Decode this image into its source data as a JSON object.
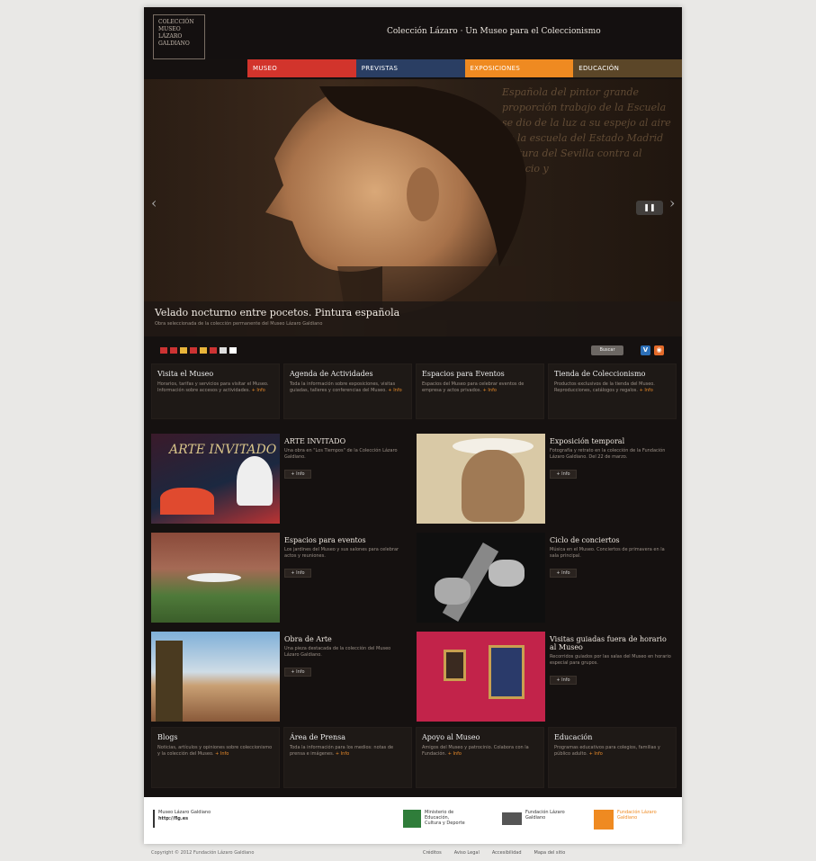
{
  "header": {
    "logo_text": "COLECCIÓN MUSEO LÁZARO GALDIANO",
    "title": "Colección Lázaro · Un Museo para el Coleccionismo"
  },
  "nav": [
    {
      "label": "MUSEO",
      "color": "#d2342c"
    },
    {
      "label": "PREVISTAS",
      "color": "#2a3e63"
    },
    {
      "label": "EXPOSICIONES",
      "color": "#ef8a21"
    },
    {
      "label": "EDUCACIÓN",
      "color": "#5b4628"
    }
  ],
  "hero": {
    "caption_title": "Velado nocturno entre pocetos. Pintura española",
    "caption_sub": "Obra seleccionada de la colección permanente del Museo Lázaro Galdiano",
    "background_text": "Española del pintor grande proporción trabajo de la Escuela se dio de la luz a su espejo al aire de la escuela del Estado Madrid pintura del Sevilla contra al espacio y"
  },
  "toolbar": {
    "search_label": "Buscar"
  },
  "flag_colors": [
    "#c33",
    "#c33",
    "#e8b43a",
    "#c33",
    "#e8b43a",
    "#c33",
    "#ddd",
    "#fff"
  ],
  "boxes": [
    {
      "title": "Visita el Museo",
      "desc": "Horarios, tarifas y servicios para visitar el Museo. Información sobre accesos y actividades.",
      "more": "+ Info"
    },
    {
      "title": "Agenda de Actividades",
      "desc": "Toda la información sobre exposiciones, visitas guiadas, talleres y conferencias del Museo.",
      "more": "+ Info"
    },
    {
      "title": "Espacios para Eventos",
      "desc": "Espacios del Museo para celebrar eventos de empresa y actos privados.",
      "more": "+ Info"
    },
    {
      "title": "Tienda de Coleccionismo",
      "desc": "Productos exclusivos de la tienda del Museo. Reproducciones, catálogos y regalos.",
      "more": "+ Info"
    }
  ],
  "cards": [
    {
      "title": "ARTE INVITADO",
      "desc": "Una obra en \"Los Tiempos\" de la Colección Lázaro Galdiano.",
      "btn": "+ Info",
      "thumb_text": "ARTE INVITADO"
    },
    {
      "title": "Exposición temporal",
      "desc": "Fotografía y retrato en la colección de la Fundación Lázaro Galdiano. Del 22 de marzo.",
      "btn": "+ Info"
    },
    {
      "title": "Espacios para eventos",
      "desc": "Los jardines del Museo y sus salones para celebrar actos y reuniones.",
      "btn": "+ Info"
    },
    {
      "title": "Ciclo de conciertos",
      "desc": "Música en el Museo. Conciertos de primavera en la sala principal.",
      "btn": "+ Info"
    },
    {
      "title": "Obra de Arte",
      "desc": "Una pieza destacada de la colección del Museo Lázaro Galdiano.",
      "btn": "+ Info"
    },
    {
      "title": "Visitas guiadas fuera de horario al Museo",
      "desc": "Recorridos guiados por las salas del Museo en horario especial para grupos.",
      "btn": "+ Info"
    }
  ],
  "bottom": [
    {
      "title": "Blogs",
      "desc": "Noticias, artículos y opiniones sobre coleccionismo y la colección del Museo.",
      "more": "+ Info"
    },
    {
      "title": "Área de Prensa",
      "desc": "Toda la información para los medios: notas de prensa e imágenes.",
      "more": "+ Info"
    },
    {
      "title": "Apoyo al Museo",
      "desc": "Amigos del Museo y patrocinio. Colabora con la Fundación.",
      "more": "+ Info"
    },
    {
      "title": "Educación",
      "desc": "Programas educativos para colegios, familias y público adulto.",
      "more": "+ Info"
    }
  ],
  "footer": {
    "left_line1": "Museo Lázaro Galdiano",
    "left_line2": "http://flg.es",
    "sponsor1": "Ministerio de Educación, Cultura y Deporte",
    "sponsor2": "Fundación Lázaro Galdiano",
    "sponsor3": "Fundación Lázaro Galdiano",
    "copyright": "Copyright © 2012 Fundación Lázaro Galdiano",
    "links": [
      "Créditos",
      "Aviso Legal",
      "Accesibilidad",
      "Mapa del sitio"
    ]
  }
}
